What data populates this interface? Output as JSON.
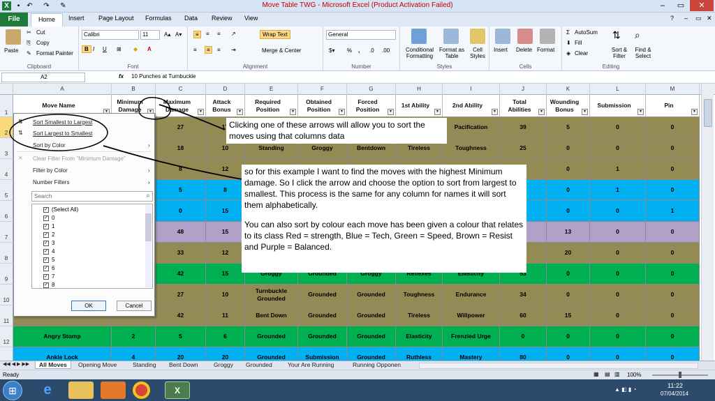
{
  "window": {
    "title": "Move Table TWG  -  Microsoft Excel (Product Activation Failed)"
  },
  "ribbon_tabs": [
    "File",
    "Home",
    "Insert",
    "Page Layout",
    "Formulas",
    "Data",
    "Review",
    "View"
  ],
  "clipboard": {
    "paste": "Paste",
    "cut": "Cut",
    "copy": "Copy",
    "format_painter": "Format Painter",
    "label": "Clipboard"
  },
  "font": {
    "name": "Calibri",
    "size": "11",
    "label": "Font"
  },
  "alignment": {
    "wrap_text": "Wrap Text",
    "merge": "Merge & Center",
    "label": "Alignment"
  },
  "number": {
    "format": "General",
    "percent": "%",
    "comma": ",",
    "label": "Number"
  },
  "styles": {
    "conditional": "Conditional Formatting",
    "format_table": "Format as Table",
    "cell_styles": "Cell Styles",
    "label": "Styles"
  },
  "cells": {
    "insert": "Insert",
    "delete": "Delete",
    "format": "Format",
    "label": "Cells"
  },
  "editing": {
    "autosum": "AutoSum",
    "fill": "Fill",
    "clear": "Clear",
    "sort": "Sort & Filter",
    "find": "Find & Select",
    "label": "Editing"
  },
  "formula_bar": {
    "name_box": "A2",
    "fx": "fx",
    "content": "10 Punches at Turnbuckle"
  },
  "columns": [
    "A",
    "B",
    "C",
    "D",
    "E",
    "F",
    "G",
    "H",
    "I",
    "J",
    "K",
    "L",
    "M"
  ],
  "headers": [
    "Move Name",
    "Minimum Damage",
    "Maximum Damage",
    "Attack Bonus",
    "Required Position",
    "Obtained Position",
    "Forced Position",
    "1st Ability",
    "2nd Ability",
    "Total Abilities",
    "Wounding Bonus",
    "Submission",
    "Pin"
  ],
  "rows": [
    {
      "n": "2",
      "cells": [
        "",
        "",
        "27",
        "17",
        "",
        "",
        "",
        "",
        "Pacification",
        "39",
        "5",
        "0",
        "0"
      ]
    },
    {
      "n": "3",
      "cells": [
        "",
        "",
        "18",
        "10",
        "Standing",
        "Groggy",
        "Bentdown",
        "Tireless",
        "Toughness",
        "25",
        "0",
        "0",
        "0"
      ]
    },
    {
      "n": "4",
      "cells": [
        "",
        "",
        "8",
        "12",
        "",
        "",
        "",
        "",
        "",
        "",
        "0",
        "1",
        "0"
      ]
    },
    {
      "n": "5",
      "cells": [
        "",
        "",
        "5",
        "8",
        "",
        "",
        "",
        "",
        "",
        "",
        "0",
        "1",
        "0"
      ]
    },
    {
      "n": "6",
      "cells": [
        "",
        "",
        "0",
        "15",
        "",
        "",
        "",
        "",
        "",
        "",
        "0",
        "0",
        "1"
      ]
    },
    {
      "n": "7",
      "cells": [
        "",
        "",
        "48",
        "15",
        "",
        "",
        "",
        "",
        "",
        "",
        "13",
        "0",
        "0"
      ]
    },
    {
      "n": "8",
      "cells": [
        "",
        "",
        "33",
        "12",
        "",
        "",
        "",
        "",
        "",
        "",
        "20",
        "0",
        "0"
      ]
    },
    {
      "n": "9",
      "cells": [
        "",
        "",
        "42",
        "15",
        "Groggy",
        "Grounded",
        "Groggy",
        "Reflexes",
        "Elasticity",
        "53",
        "0",
        "0",
        "0"
      ]
    },
    {
      "n": "10",
      "cells": [
        "",
        "",
        "27",
        "10",
        "Turnbuckle Grounded",
        "Grounded",
        "Grounded",
        "Toughness",
        "Endurance",
        "34",
        "0",
        "0",
        "0"
      ]
    },
    {
      "n": "11",
      "cells": [
        "",
        "",
        "42",
        "11",
        "Bent Down",
        "Grounded",
        "Grounded",
        "Tireless",
        "Willpower",
        "60",
        "15",
        "0",
        "0"
      ]
    },
    {
      "n": "12",
      "cells": [
        "Angry Stomp",
        "2",
        "5",
        "6",
        "Grounded",
        "Grounded",
        "Grounded",
        "Elasticity",
        "Frenzied Urge",
        "0",
        "0",
        "0",
        "0"
      ]
    },
    {
      "n": "13",
      "cells": [
        "Ankle Lock",
        "4",
        "20",
        "20",
        "Grounded",
        "Submission",
        "Grounded",
        "Ruthless",
        "Mastery",
        "80",
        "0",
        "0",
        "0"
      ]
    }
  ],
  "row_colors": [
    "#948a54",
    "#948a54",
    "#948a54",
    "#00b0f0",
    "#00b0f0",
    "#b1a0c7",
    "#948a54",
    "#00b050",
    "#948a54",
    "#948a54",
    "#00b050",
    "#00b0f0"
  ],
  "filter_menu": {
    "sort_asc": "Sort Smallest to Largest",
    "sort_desc": "Sort Largest to Smallest",
    "sort_color": "Sort by Color",
    "clear_filter": "Clear Filter From \"Minimum Damage\"",
    "filter_color": "Filter by Color",
    "number_filters": "Number Filters",
    "search_placeholder": "Search",
    "items": [
      "(Select All)",
      "0",
      "1",
      "2",
      "3",
      "4",
      "5",
      "6",
      "7",
      "8"
    ],
    "ok": "OK",
    "cancel": "Cancel"
  },
  "notes": {
    "note1": "Clicking one of these arrows will allow you to sort the moves using that columns data",
    "note2_p1": "so for this example I want to find the moves with the highest Minimum damage. So I click the arrow and choose the option to sort from largest to smallest. This process is the same for any column for names it will sort them alphabetically.",
    "note2_p2": "You can also sort by colour each move has been given a colour that relates to its class Red = strength, Blue = Tech, Green = Speed, Brown = Resist and Purple = Balanced."
  },
  "sheet_tabs": [
    "All Moves",
    "Opening Move",
    "Standing",
    "Bent Down",
    "Groggy",
    "Grounded",
    "Your Are Running",
    "Running Opponen"
  ],
  "status": {
    "ready": "Ready",
    "zoom": "100%"
  },
  "clock": {
    "time": "11:22",
    "date": "07/04/2014"
  }
}
